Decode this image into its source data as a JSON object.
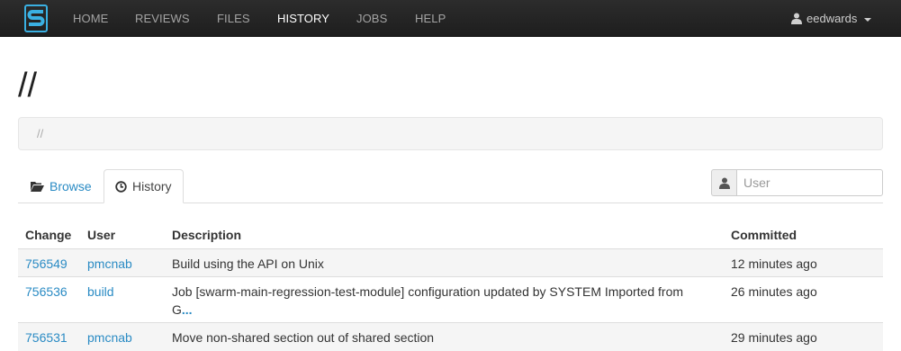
{
  "nav": {
    "items": [
      {
        "label": "HOME",
        "active": false
      },
      {
        "label": "REVIEWS",
        "active": false
      },
      {
        "label": "FILES",
        "active": false
      },
      {
        "label": "HISTORY",
        "active": true
      },
      {
        "label": "JOBS",
        "active": false
      },
      {
        "label": "HELP",
        "active": false
      }
    ],
    "user": "eedwards",
    "user_icon": "user-icon",
    "logo_icon": "swarm-logo"
  },
  "page": {
    "title": "//",
    "breadcrumb": "//"
  },
  "tabs": {
    "browse": {
      "label": "Browse",
      "icon": "folder-open-icon"
    },
    "history": {
      "label": "History",
      "icon": "clock-icon"
    }
  },
  "filter": {
    "placeholder": "User",
    "icon": "user-icon"
  },
  "table": {
    "headers": {
      "change": "Change",
      "user": "User",
      "description": "Description",
      "committed": "Committed"
    },
    "rows": [
      {
        "change": "756549",
        "user": "pmcnab",
        "description": "Build using the API on Unix",
        "more": "",
        "committed": "12 minutes ago"
      },
      {
        "change": "756536",
        "user": "build",
        "description": "Job [swarm-main-regression-test-module] configuration updated by SYSTEM Imported from G",
        "more": "...",
        "committed": "26 minutes ago"
      },
      {
        "change": "756531",
        "user": "pmcnab",
        "description": "Move non-shared section out of shared section",
        "more": "",
        "committed": "29 minutes ago"
      }
    ]
  },
  "colors": {
    "navbar": "#222222",
    "link": "#2a8bc4",
    "stripe": "#f5f5f5",
    "logo": "#3ab0e2"
  }
}
